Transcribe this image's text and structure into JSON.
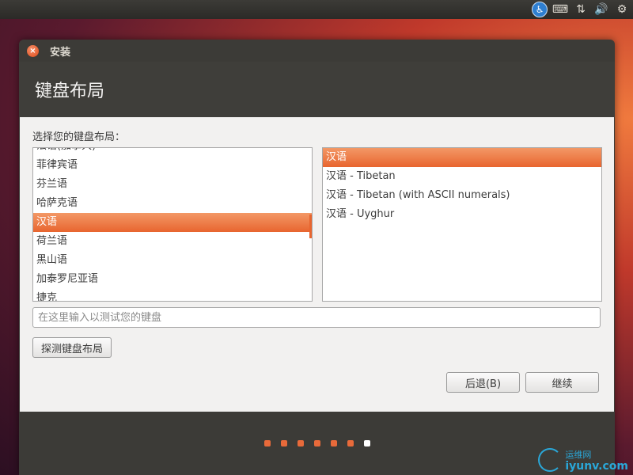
{
  "top_panel": {
    "icons": [
      "accessibility-icon",
      "keyboard-icon",
      "network-icon",
      "volume-icon",
      "gear-icon"
    ]
  },
  "window": {
    "title": "安装",
    "header_title": "键盘布局",
    "prompt": "选择您的键盘布局：",
    "layouts": [
      "法语(加拿大)",
      "菲律宾语",
      "芬兰语",
      "哈萨克语",
      "汉语",
      "荷兰语",
      "黑山语",
      "加泰罗尼亚语",
      "捷克"
    ],
    "selected_layout": "汉语",
    "variants": [
      "汉语",
      "汉语 - Tibetan",
      "汉语 - Tibetan (with ASCII numerals)",
      "汉语 - Uyghur"
    ],
    "selected_variant": "汉语",
    "test_placeholder": "在这里输入以测试您的键盘",
    "detect_button": "探测键盘布局",
    "back_button": "后退(B)",
    "continue_button": "继续",
    "progress": {
      "total": 7,
      "current": 7
    }
  },
  "colors": {
    "accent": "#e8652f",
    "window_bg": "#3c3b37",
    "content_bg": "#f2f1f0"
  },
  "watermark": {
    "top": "运维网",
    "bottom": "iyunv.com"
  }
}
